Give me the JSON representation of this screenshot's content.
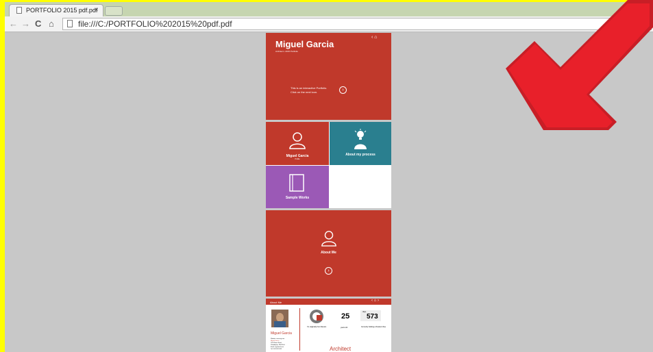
{
  "browser": {
    "tab_title": "PORTFOLIO 2015 pdf.pdf",
    "tab_close": "×",
    "back": "←",
    "forward": "→",
    "reload": "C",
    "home": "⌂",
    "url": "file:///C:/PORTFOLIO%202015%20pdf.pdf"
  },
  "cover": {
    "name": "Miguel Garcia",
    "subtitle": "Architect • 2015 Portfolio",
    "intro": "This is an interactive Portfolio. Click on the next icon.",
    "next_glyph": "›",
    "top_icons": "‹ ⌂"
  },
  "menu": {
    "tile1_label": "Miguel Garcia",
    "tile1_sub": "Profile",
    "tile2_label": "About my process",
    "tile3_label": "Sample Works"
  },
  "about_cover": {
    "label": "About Me",
    "next_glyph": "›"
  },
  "about_page": {
    "header": "About Me",
    "header_icons": "‹ ⌂ ›",
    "name": "Miguel Garcia",
    "contact_lines": [
      "Website: www.mg.com",
      "Miguel Garcia",
      "1234 Street Road",
      "Philadelphia, PA 19104",
      "Email: mg@mail.com",
      "Tel: 555-555-5555"
    ],
    "origin_caption": "I'm originally from Mexico",
    "age": "25",
    "age_caption": "years old",
    "count_label": "days",
    "count": "573",
    "count_caption": "Currently holding a Student Visa",
    "profession": "Architect"
  },
  "colors": {
    "red": "#c0392b",
    "teal": "#2a7f8f",
    "purple": "#9b59b6",
    "highlight_yellow": "#ffff00",
    "arrow_red": "#e8202a"
  }
}
